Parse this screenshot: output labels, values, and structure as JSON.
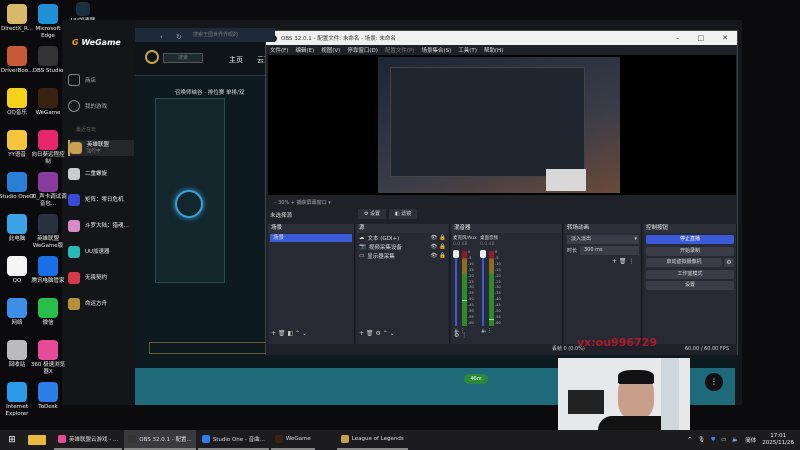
{
  "desktop": {
    "icons": [
      {
        "label": "DirectX_R...",
        "color": "#d8b86a"
      },
      {
        "label": "Microsoft Edge",
        "color": "#1f8fd6"
      },
      {
        "label": "DriverBoo...",
        "color": "#c85a3a"
      },
      {
        "label": "OBS Studio",
        "color": "#333"
      },
      {
        "label": "QQ音乐",
        "color": "#f5d21a"
      },
      {
        "label": "WeGame",
        "color": "#3a2212"
      },
      {
        "label": "YY语音",
        "color": "#f3c43c"
      },
      {
        "label": "向日葵远程控制",
        "color": "#e8266b"
      },
      {
        "label": "Studio One 7",
        "color": "#2a7ed6"
      },
      {
        "label": "00_声卡调试调音包...",
        "color": "#8a3b9e"
      },
      {
        "label": "此电脑",
        "color": "#3da3e8"
      },
      {
        "label": "英雄联盟WeGame版",
        "color": "#2a3240"
      },
      {
        "label": "QQ",
        "color": "#f5f5f5"
      },
      {
        "label": "腾讯电脑管家",
        "color": "#1a6ee8"
      },
      {
        "label": "网络",
        "color": "#3d8ee8"
      },
      {
        "label": "微信",
        "color": "#2bbd4a"
      },
      {
        "label": "回收站",
        "color": "#bbbbbb"
      },
      {
        "label": "360 极速浏览器X",
        "color": "#e84a9a"
      },
      {
        "label": "Internet Explorer",
        "color": "#2a9ae8"
      },
      {
        "label": "ToDesk",
        "color": "#2a7ee8"
      }
    ],
    "top_icon": "UU加速器"
  },
  "wegame": {
    "logo": "WeGame",
    "nav": [
      "商店",
      "我的游戏"
    ],
    "recent_label": "最近在玩",
    "games": [
      {
        "name": "英雄联盟",
        "status": "运行中",
        "color": "#c8a050"
      },
      {
        "name": "二重螺旋",
        "color": "#ccc"
      },
      {
        "name": "矩阵：零日危机",
        "color": "#3a4ad8"
      },
      {
        "name": "斗罗大陆：猎魂...",
        "color": "#d88ac8"
      },
      {
        "name": "UU加速器",
        "color": "#2ab8b8"
      },
      {
        "name": "无畏契约",
        "color": "#d83a4a"
      },
      {
        "name": "命运方舟",
        "color": "#b8903a"
      }
    ],
    "search_placeholder": "搜索王国世界界眼的"
  },
  "lol": {
    "nav": [
      "主页",
      "云顶"
    ],
    "mode": "召唤师峡谷 · 排位赛 单排/双",
    "search": "搜索",
    "badge": "46m"
  },
  "obs": {
    "title": "OBS 32.0.1 - 配置文件: 未命名 - 场景: 未命名",
    "menu": [
      "文件(F)",
      "编辑(E)",
      "视图(V)",
      "停靠窗口(D)",
      "配置文件(P)",
      "场景集合(S)",
      "工具(T)",
      "帮助(H)"
    ],
    "zoom": "30%",
    "preview_window": "捕获屏幕窗口",
    "no_source": "未选择源",
    "props": "设置",
    "filters": "滤镜",
    "scenes_title": "场景",
    "scenes": [
      "场景"
    ],
    "sources_title": "源",
    "sources": [
      "文本 (GDI+)",
      "视频采集设备",
      "显示器采集"
    ],
    "mixer_title": "混音器",
    "channels": [
      {
        "name": "麦克风/Aux",
        "db": "0.0 dB",
        "level": 0.35
      },
      {
        "name": "桌面音频",
        "db": "0.0 dB",
        "level": 0.1
      }
    ],
    "meter_ticks": [
      "0",
      "-5",
      "-10",
      "-15",
      "-20",
      "-25",
      "-30",
      "-35",
      "-40",
      "-45",
      "-50",
      "-55",
      "-60"
    ],
    "transitions_title": "转场动画",
    "transition": "淡入淡出",
    "duration_label": "时长",
    "duration": "300 ms",
    "controls_title": "控制按钮",
    "controls": [
      "停止直播",
      "开始录制",
      "启动虚拟摄像机",
      "工作室模式",
      "设置"
    ],
    "status": {
      "dropped": "丢帧 0 (0.0%)",
      "fps": "60.00 / 60.00 FPS"
    }
  },
  "watermark": "vx:ou996729",
  "taskbar": {
    "items": [
      "英雄联盟云游戏 - ...",
      "OBS 32.0.1 - 配置...",
      "Studio One - 音曲...",
      "WeGame",
      "League of Legends"
    ],
    "ime": "简体",
    "time": "17:01",
    "date": "2025/11/26"
  }
}
